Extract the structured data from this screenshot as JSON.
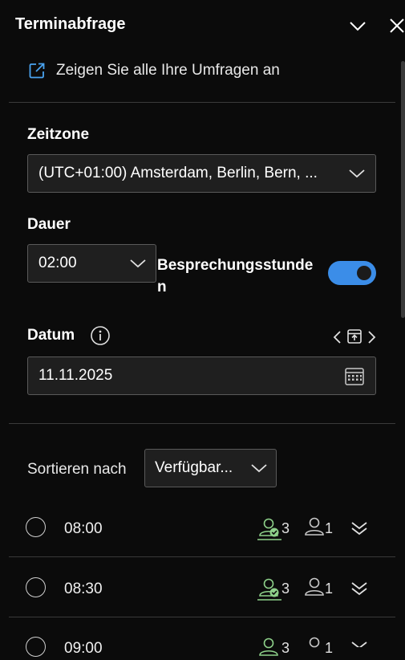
{
  "header": {
    "title": "Terminabfrage"
  },
  "link": {
    "label": "Zeigen Sie alle Ihre Umfragen an"
  },
  "timezone": {
    "label": "Zeitzone",
    "value": "(UTC+01:00) Amsterdam, Berlin, Bern, ..."
  },
  "duration": {
    "label": "Dauer",
    "value": "02:00"
  },
  "business_hours": {
    "label_line1": "Besprechungsstunde",
    "label_line2": "n",
    "enabled": true
  },
  "date": {
    "label": "Datum",
    "value": "11.11.2025"
  },
  "sort": {
    "label": "Sortieren nach",
    "value": "Verfügbar..."
  },
  "slots": [
    {
      "time": "08:00",
      "available": "3",
      "unknown": "1"
    },
    {
      "time": "08:30",
      "available": "3",
      "unknown": "1"
    },
    {
      "time": "09:00",
      "available": "3",
      "unknown": "1"
    }
  ],
  "colors": {
    "accent": "#3b8de8",
    "available": "#8ed18a",
    "background": "#0b0b0b"
  }
}
